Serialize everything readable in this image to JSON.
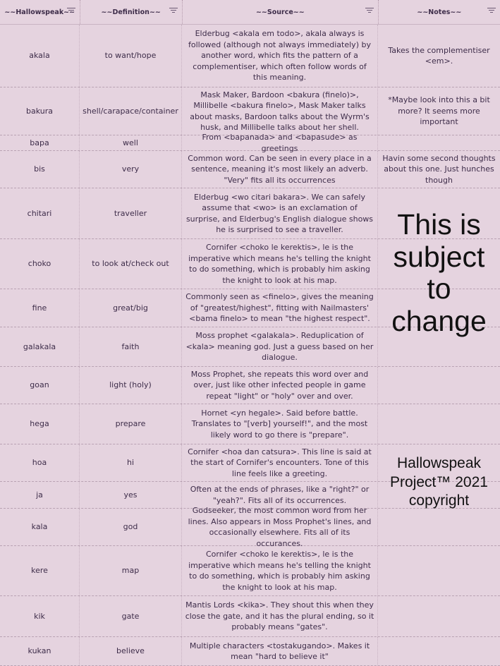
{
  "headers": [
    "~~Hallowspeak~~",
    "~~Definition~~",
    "~~Source~~",
    "~~Notes~~"
  ],
  "rows": [
    {
      "word": "akala",
      "def": "to want/hope",
      "source": "Elderbug <akala em todo>, akala always is followed (although not always immediately) by another word, which fits the pattern of a complementiser, which often follow words of this meaning.",
      "note": "Takes the complementiser <em>."
    },
    {
      "word": "bakura",
      "def": "shell/carapace/container",
      "source": "Mask Maker, Bardoon <bakura (finelo)>, Millibelle <bakura finelo>, Mask Maker talks about masks, Bardoon talks about the Wyrm's husk, and Millibelle talks about her shell.",
      "note": "*Maybe look into this a bit more? It seems more important"
    },
    {
      "word": "bapa",
      "def": "well",
      "source": "From <bapanada> and <bapasude> as greetings",
      "note": ""
    },
    {
      "word": "bis",
      "def": "very",
      "source": "Common word. Can be seen in every place in a sentence, meaning it's most likely an adverb. \"Very\" fits all its occurrences",
      "note": "Havin some second thoughts about this one. Just hunches though"
    },
    {
      "word": "chitari",
      "def": "traveller",
      "source": "Elderbug <wo citari bakara>. We can safely assume that <wo> is an exclamation of surprise, and Elderbug's English dialogue shows he is surprised to see a traveller.",
      "note": ""
    },
    {
      "word": "choko",
      "def": "to look at/check out",
      "source": "Cornifer <choko le kerektis>, le is the imperative which means he's telling the knight to do something, which is probably him asking the knight to look at his map.",
      "note": ""
    },
    {
      "word": "fine",
      "def": "great/big",
      "source": "Commonly seen as <finelo>, gives the meaning of \"greatest/highest\", fitting with Nailmasters' <bama finelo> to mean \"the highest respect\".",
      "note": ""
    },
    {
      "word": "galakala",
      "def": "faith",
      "source": "Moss prophet <galakala>. Reduplication of <kala> meaning god. Just a guess based on her dialogue.",
      "note": ""
    },
    {
      "word": "goan",
      "def": "light (holy)",
      "source": "Moss Prophet, she repeats this word over and over, just like other infected people in game repeat \"light\" or \"holy\" over and over.",
      "note": ""
    },
    {
      "word": "hega",
      "def": "prepare",
      "source": "Hornet <yn hegale>. Said before battle. Translates to \"[verb] yourself!\", and the most likely word to go there is \"prepare\".",
      "note": ""
    },
    {
      "word": "hoa",
      "def": "hi",
      "source": "Cornifer <hoa dan catsura>. This line is said at the start of Cornifer's encounters. Tone of this line feels like a greeting.",
      "note": ""
    },
    {
      "word": "ja",
      "def": "yes",
      "source": "Often at the ends of phrases, like a \"right?\" or \"yeah?\". Fits all of its occurrences.",
      "note": ""
    },
    {
      "word": "kala",
      "def": "god",
      "source": "Godseeker, the most common word from her lines. Also appears in Moss Prophet's lines, and occasionally elsewhere. Fits all of its occurances.",
      "note": ""
    },
    {
      "word": "kere",
      "def": "map",
      "source": "Cornifer <choko le kerektis>, le is the imperative which means he's telling the knight to do something, which is probably him asking the knight to look at his map.",
      "note": ""
    },
    {
      "word": "kik",
      "def": "gate",
      "source": "Mantis Lords <kika>. They shout this when they close the gate, and it has the plural ending, so it probably means \"gates\".",
      "note": ""
    },
    {
      "word": "kukan",
      "def": "believe",
      "source": "Multiple characters <tostakugando>. Makes it mean \"hard to believe it\"",
      "note": ""
    }
  ],
  "overlay_big": [
    "This is",
    "subject",
    "to",
    "change"
  ],
  "overlay_copyright": [
    "Hallowspeak",
    "Project™ 2021",
    "copyright"
  ]
}
